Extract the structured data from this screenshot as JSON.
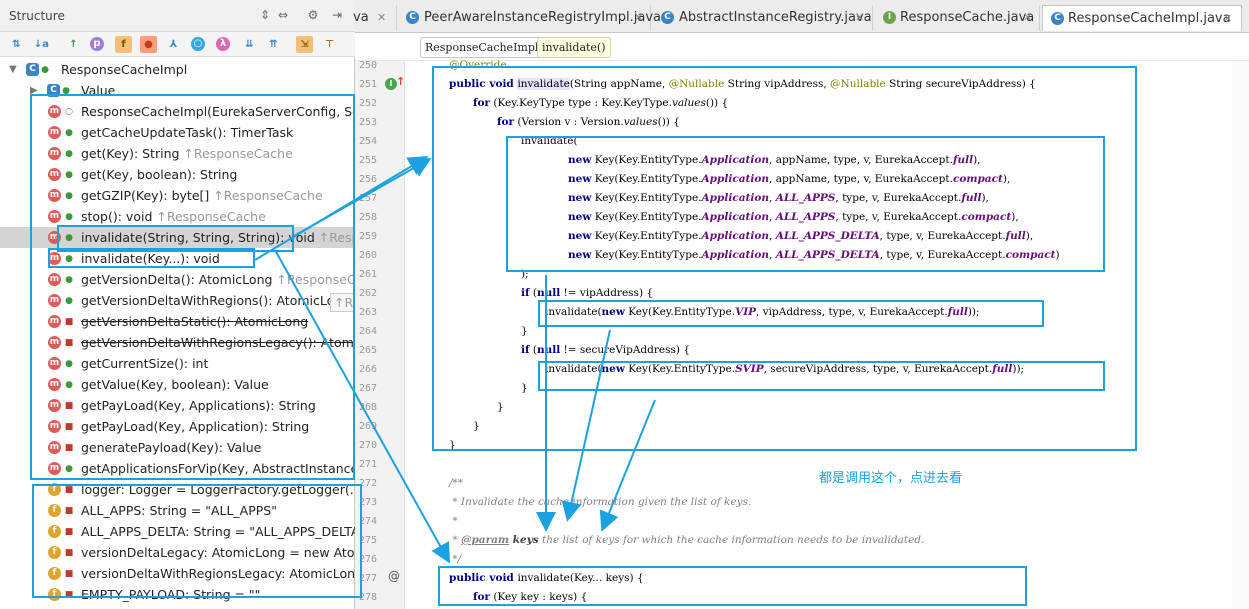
{
  "structure": {
    "title": "Structure",
    "header_icons": [
      "expand-all-icon",
      "collapse-all-icon",
      "settings-icon",
      "hide-icon"
    ],
    "toolbar_icons": [
      "sort-visibility-icon",
      "sort-alpha-icon",
      "inherited-icon",
      "properties-icon",
      "fields-icon",
      "non-public-icon",
      "anonymous-icon",
      "lambda-icon",
      "expand-icon",
      "collapse-icon",
      "autoscroll-to-source-icon",
      "autoscroll-from-source-icon"
    ],
    "tooltip": "↑ResponseCache",
    "items": [
      {
        "label": "ResponseCacheImpl",
        "tail": "",
        "kind": "c"
      },
      {
        "label": "Value",
        "tail": "",
        "kind": "c"
      },
      {
        "label": "ResponseCacheImpl(EurekaServerConfig, Serve",
        "tail": "",
        "kind": "m"
      },
      {
        "label": "getCacheUpdateTask(): TimerTask",
        "tail": "",
        "kind": "m"
      },
      {
        "label": "get(Key): String ",
        "tail": "↑ResponseCache",
        "kind": "m"
      },
      {
        "label": "get(Key, boolean): String",
        "tail": "",
        "kind": "m"
      },
      {
        "label": "getGZIP(Key): byte[] ",
        "tail": "↑ResponseCache",
        "kind": "m"
      },
      {
        "label": "stop(): void ",
        "tail": "↑ResponseCache",
        "kind": "m"
      },
      {
        "label": "invalidate(String, String, String): void ",
        "tail": "↑Respons",
        "kind": "m"
      },
      {
        "label": "invalidate(Key...): void",
        "tail": "",
        "kind": "m"
      },
      {
        "label": "getVersionDelta(): AtomicLong ",
        "tail": "↑ResponseCach",
        "kind": "m"
      },
      {
        "label": "getVersionDeltaWithRegions(): AtomicLong ",
        "tail": "",
        "kind": "m"
      },
      {
        "label": "getVersionDeltaStatic(): AtomicLong",
        "tail": "",
        "kind": "m"
      },
      {
        "label": "getVersionDeltaWithRegionsLegacy(): AtomicLe",
        "tail": "",
        "kind": "m"
      },
      {
        "label": "getCurrentSize(): int",
        "tail": "",
        "kind": "m"
      },
      {
        "label": "getValue(Key, boolean): Value",
        "tail": "",
        "kind": "m"
      },
      {
        "label": "getPayLoad(Key, Applications): String",
        "tail": "",
        "kind": "m"
      },
      {
        "label": "getPayLoad(Key, Application): String",
        "tail": "",
        "kind": "m"
      },
      {
        "label": "generatePayload(Key): Value",
        "tail": "",
        "kind": "m"
      },
      {
        "label": "getApplicationsForVip(Key, AbstractInstanceReg",
        "tail": "",
        "kind": "m"
      },
      {
        "label": "logger: Logger = LoggerFactory.getLogger(...)",
        "tail": "",
        "kind": "f"
      },
      {
        "label": "ALL_APPS: String = \"ALL_APPS\"",
        "tail": "",
        "kind": "f"
      },
      {
        "label": "ALL_APPS_DELTA: String = \"ALL_APPS_DELTA\"",
        "tail": "",
        "kind": "f"
      },
      {
        "label": "versionDeltaLegacy: AtomicLong = new Atomic",
        "tail": "",
        "kind": "f"
      },
      {
        "label": "versionDeltaWithRegionsLegacy: AtomicLong =",
        "tail": "",
        "kind": "f"
      },
      {
        "label": "EMPTY_PAYLOAD: String = \"\"",
        "tail": "",
        "kind": "f"
      }
    ]
  },
  "tabs": [
    {
      "label": "va",
      "icon": "class-icon"
    },
    {
      "label": "PeerAwareInstanceRegistryImpl.java",
      "icon": "class-icon"
    },
    {
      "label": "AbstractInstanceRegistry.java",
      "icon": "class-icon"
    },
    {
      "label": "ResponseCache.java",
      "icon": "interface-icon"
    },
    {
      "label": "ResponseCacheImpl.java",
      "icon": "class-icon"
    }
  ],
  "breadcrumbs": [
    "ResponseCacheImpl",
    "invalidate()"
  ],
  "line_numbers": [
    "250",
    "251",
    "252",
    "253",
    "254",
    "255",
    "256",
    "257",
    "258",
    "259",
    "260",
    "261",
    "262",
    "263",
    "264",
    "265",
    "266",
    "267",
    "268",
    "269",
    "270",
    "271",
    "272",
    "273",
    "274",
    "275",
    "276",
    "277",
    "278"
  ],
  "code": {
    "l250": "@Override",
    "l251a": "public void ",
    "l251b": "invalidate",
    "l251c": "(String appName, ",
    "l251d": "@Nullable",
    "l251e": " String vipAddress, ",
    "l251f": "@Nullable",
    "l251g": " String secureVipAddress) {",
    "l252a": "for",
    "l252b": " (Key.KeyType type : Key.KeyType.",
    "l252c": "values",
    "l252d": "()) {",
    "l253a": "for",
    "l253b": " (Version v : Version.",
    "l253c": "values",
    "l253d": "()) {",
    "l254": "invalidate(",
    "new_kw": "new",
    "key_et": " Key(Key.EntityType.",
    "application": "Application",
    "all_apps": "ALL_APPS",
    "all_apps_delta": "ALL_APPS_DELTA",
    "full": "full",
    "compact": "compact",
    "l255b": ", appName, type, v, EurekaAccept.",
    "l257b": ", type, v, EurekaAccept.",
    "l255end": "),",
    "l260end": ")",
    "l261": ");",
    "l262a": "if",
    "l262b": " (",
    "null_kw": "null",
    "l262c": " != vipAddress) {",
    "l263a": "invalidate(",
    "vip": "VIP",
    "l263c": ", vipAddress, type, v, EurekaAccept.",
    "l263end": "));",
    "brace": "}",
    "l265c": " != secureVipAddress) {",
    "svip": "SVIP",
    "l266c": ", secureVipAddress, type, v, EurekaAccept.",
    "l271": "/**",
    "l272": " * Invalidate the cache information given the list of keys.",
    "l273": " *",
    "l274a": " * ",
    "l274b": "@param",
    "l274c": " keys",
    "l274d": " the list of keys for which the cache information needs to be invalidated.",
    "l275": " */",
    "l276a": "public void ",
    "l276b": "invalidate(Key... keys) {",
    "l277a": "for",
    "l277b": " (Key key : keys) {"
  },
  "annotation_note": "都是调用这个，点进去看",
  "colors": {
    "annotation": "#1ba1e2",
    "keyword": "#000080",
    "constant": "#660e7a",
    "comment": "#808080",
    "annotation_code": "#808000"
  }
}
